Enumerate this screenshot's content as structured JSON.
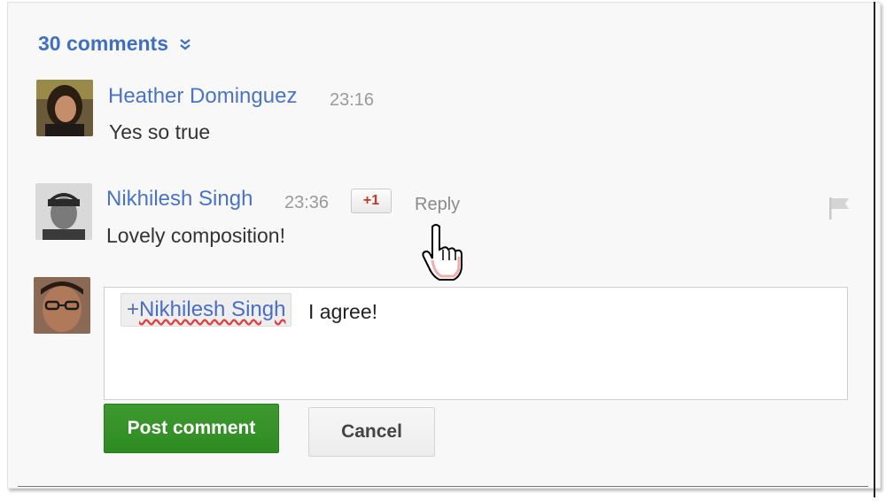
{
  "comments_header": {
    "count_label": "30 comments",
    "expand_icon": "double-chevron-down-icon"
  },
  "comments": [
    {
      "author": "Heather Dominguez",
      "time": "23:16",
      "text": "Yes so true",
      "avatar_icon": "user-avatar"
    },
    {
      "author": "Nikhilesh Singh",
      "time": "23:36",
      "text": "Lovely composition!",
      "plus_one_label": "+1",
      "reply_label": "Reply",
      "avatar_icon": "user-avatar",
      "flag_icon": "flag-icon"
    }
  ],
  "reply_box": {
    "mention_plus": "+",
    "mention_name": "Nikhilesh Singh",
    "draft_text": "I agree!",
    "avatar_icon": "user-avatar"
  },
  "actions": {
    "post_label": "Post comment",
    "cancel_label": "Cancel"
  },
  "colors": {
    "link_blue": "#4a73c4",
    "post_green": "#35912a",
    "plus_one_red": "#c0392b"
  }
}
